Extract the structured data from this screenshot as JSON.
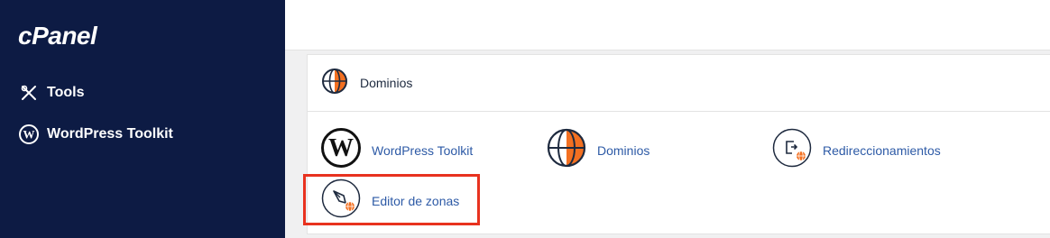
{
  "brand": {
    "logo_text": "cPanel"
  },
  "sidebar": {
    "items": [
      {
        "label": "Tools",
        "icon": "tools-icon"
      },
      {
        "label": "WordPress Toolkit",
        "icon": "wordpress-icon"
      }
    ]
  },
  "section": {
    "title": "Dominios",
    "icon": "globe-icon",
    "tools": [
      {
        "label": "WordPress Toolkit",
        "icon": "wordpress-icon"
      },
      {
        "label": "Dominios",
        "icon": "globe-icon"
      },
      {
        "label": "Redireccionamientos",
        "icon": "redirect-icon"
      },
      {
        "label": "Editor de zonas",
        "icon": "zone-editor-icon"
      }
    ]
  },
  "colors": {
    "sidebar_bg": "#0d1b44",
    "link": "#2d5aa6",
    "accent": "#f37021",
    "highlight": "#e8321f"
  }
}
